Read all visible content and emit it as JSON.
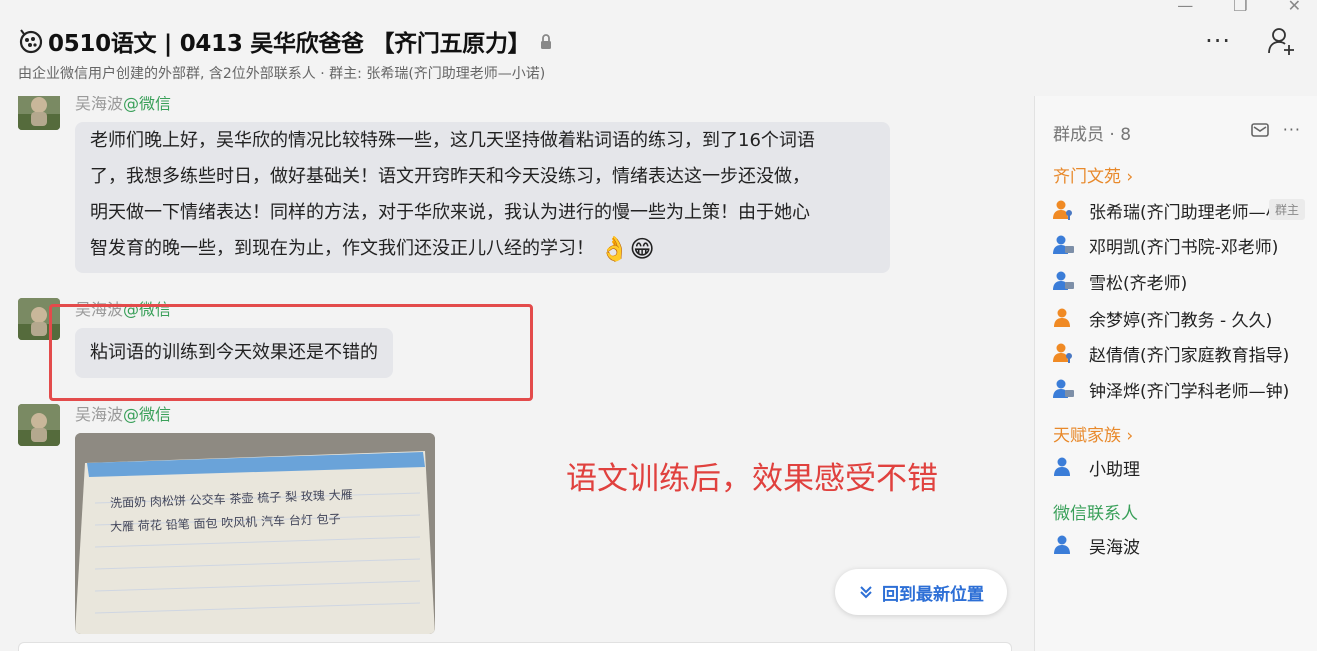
{
  "header": {
    "title": "0510语文 | 0413  吴华欣爸爸 【齐门五原力】",
    "subtitle": "由企业微信用户创建的外部群, 含2位外部联系人 · 群主: 张希瑞(齐门助理老师—小诺)",
    "window_min": "—",
    "window_max": "❐",
    "window_close": "✕",
    "more_label": "···"
  },
  "messages": [
    {
      "sender": "吴海波",
      "source": "@微信",
      "text_lines": [
        "老师们晚上好，吴华欣的情况比较特殊一些，这几天坚持做着粘词语的练习，到了16个词语",
        "了，我想多练些时日，做好基础关！语文开窍昨天和今天没练习，情绪表达这一步还没做，",
        "明天做一下情绪表达！同样的方法，对于华欣来说，我认为进行的慢一些为上策！由于她心",
        "智发育的晚一些，到现在为止，作文我们还没正儿八经的学习！"
      ],
      "emoji": "👌😁"
    },
    {
      "sender": "吴海波",
      "source": "@微信",
      "text": "粘词语的训练到今天效果还是不错的"
    },
    {
      "sender": "吴海波",
      "source": "@微信",
      "image_caption": [
        "洗面奶  肉松饼  公交车  茶壶  梳子  梨  玫瑰  大雁",
        "大雁  荷花  铅笔  面包  吹风机  汽车  台灯  包子"
      ]
    }
  ],
  "annotation": "语文训练后，效果感受不错",
  "jump_button": {
    "label": "回到最新位置"
  },
  "panel": {
    "title": "群成员 · 8",
    "groups": [
      {
        "name": "齐门文苑 ›",
        "color": "#e8892b",
        "members": [
          {
            "name": "张希瑞(齐门助理老师—小诺)",
            "badge": "群主",
            "icon": "orange-person-key"
          },
          {
            "name": "邓明凯(齐门书院-邓老师)",
            "icon": "blue-person-screen"
          },
          {
            "name": "雪松(齐老师)",
            "icon": "blue-person-screen"
          },
          {
            "name": "余梦婷(齐门教务 - 久久)",
            "icon": "orange-person"
          },
          {
            "name": "赵倩倩(齐门家庭教育指导)",
            "icon": "orange-person-key"
          },
          {
            "name": "钟泽烨(齐门学科老师—钟)",
            "icon": "blue-person-screen"
          }
        ]
      },
      {
        "name": "天赋家族 ›",
        "color": "#e8892b",
        "members": [
          {
            "name": "小助理",
            "icon": "blue-person"
          }
        ]
      },
      {
        "name": "微信联系人",
        "color": "#3aa05a",
        "members": [
          {
            "name": "吴海波",
            "icon": "blue-person"
          }
        ]
      }
    ]
  },
  "colors": {
    "accent_blue": "#2d6fd6",
    "annotation_red": "#e0413e",
    "wechat_green": "#3aa05a",
    "group_orange": "#e8892b"
  }
}
